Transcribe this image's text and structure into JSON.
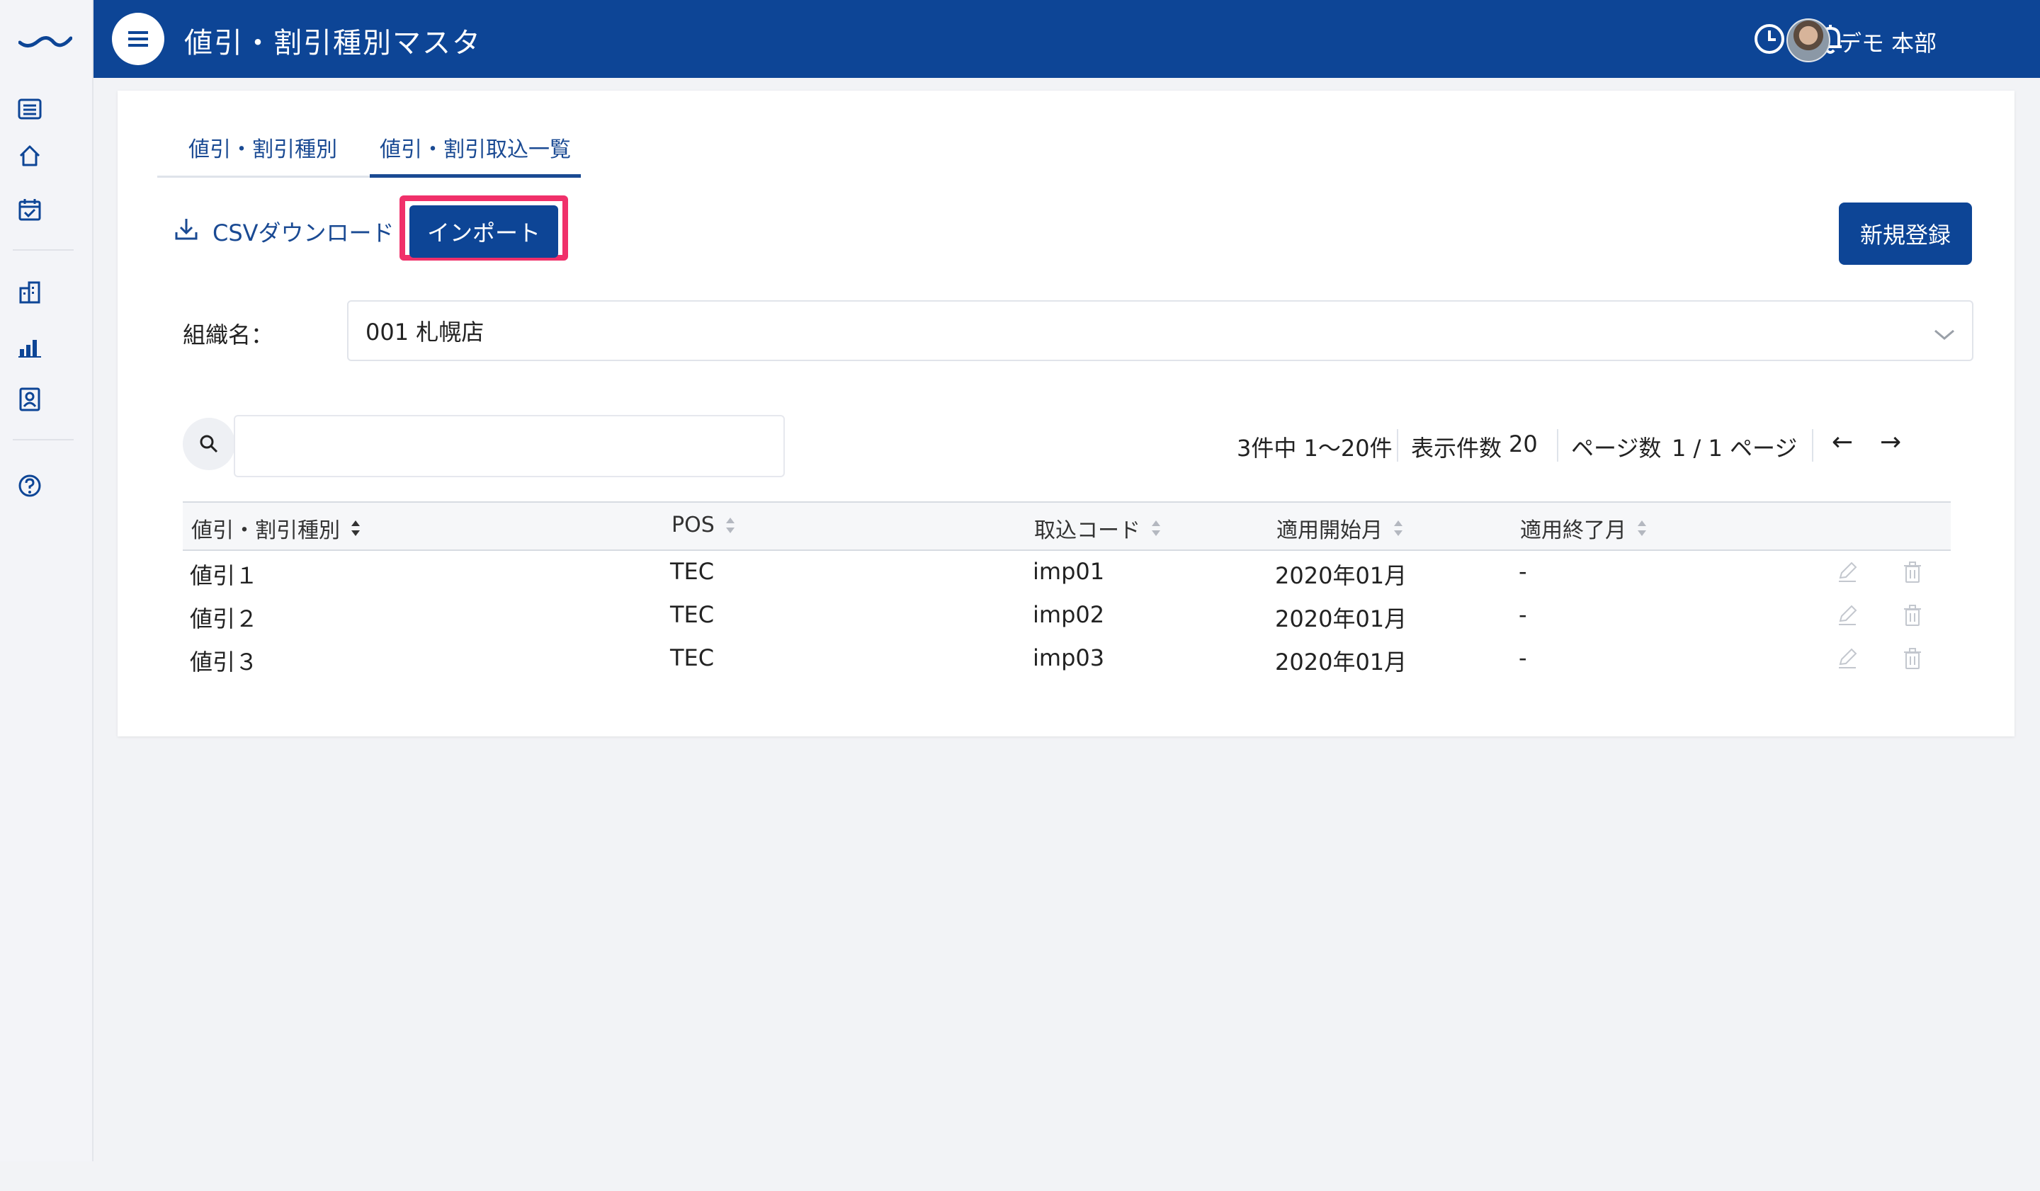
{
  "header": {
    "title": "値引・割引種別マスタ",
    "user_name": "デモ 本部",
    "brand_color": "#0d4596"
  },
  "tabs": [
    {
      "label": "値引・割引種別"
    },
    {
      "label": "値引・割引取込一覧"
    }
  ],
  "toolbar": {
    "csv_label": "CSVダウンロード",
    "import_label": "インポート",
    "new_label": "新規登録"
  },
  "filter": {
    "org_label": "組織名：",
    "org_value": "001 札幌店"
  },
  "search": {
    "placeholder": ""
  },
  "pager": {
    "range": "3件中 1〜20件",
    "per_page_label": "表示件数",
    "per_page_value": "20",
    "page_label": "ページ数",
    "page_value": "1 / 1 ページ",
    "prev": "←",
    "next": "→"
  },
  "table": {
    "columns": [
      "値引・割引種別",
      "POS",
      "取込コード",
      "適用開始月",
      "適用終了月"
    ],
    "rows": [
      [
        "値引１",
        "TEC",
        "imp01",
        "2020年01月",
        "-"
      ],
      [
        "値引２",
        "TEC",
        "imp02",
        "2020年01月",
        "-"
      ],
      [
        "値引３",
        "TEC",
        "imp03",
        "2020年01月",
        "-"
      ]
    ]
  },
  "icons": {
    "rail": [
      "list-icon",
      "home-icon",
      "calendar-check-icon",
      "building-icon",
      "bar-chart-icon",
      "id-card-icon",
      "help-icon"
    ],
    "header": [
      "clock-icon",
      "bell-icon"
    ],
    "row_actions": [
      "edit-icon",
      "delete-icon"
    ]
  },
  "highlight_color": "#f0306a"
}
